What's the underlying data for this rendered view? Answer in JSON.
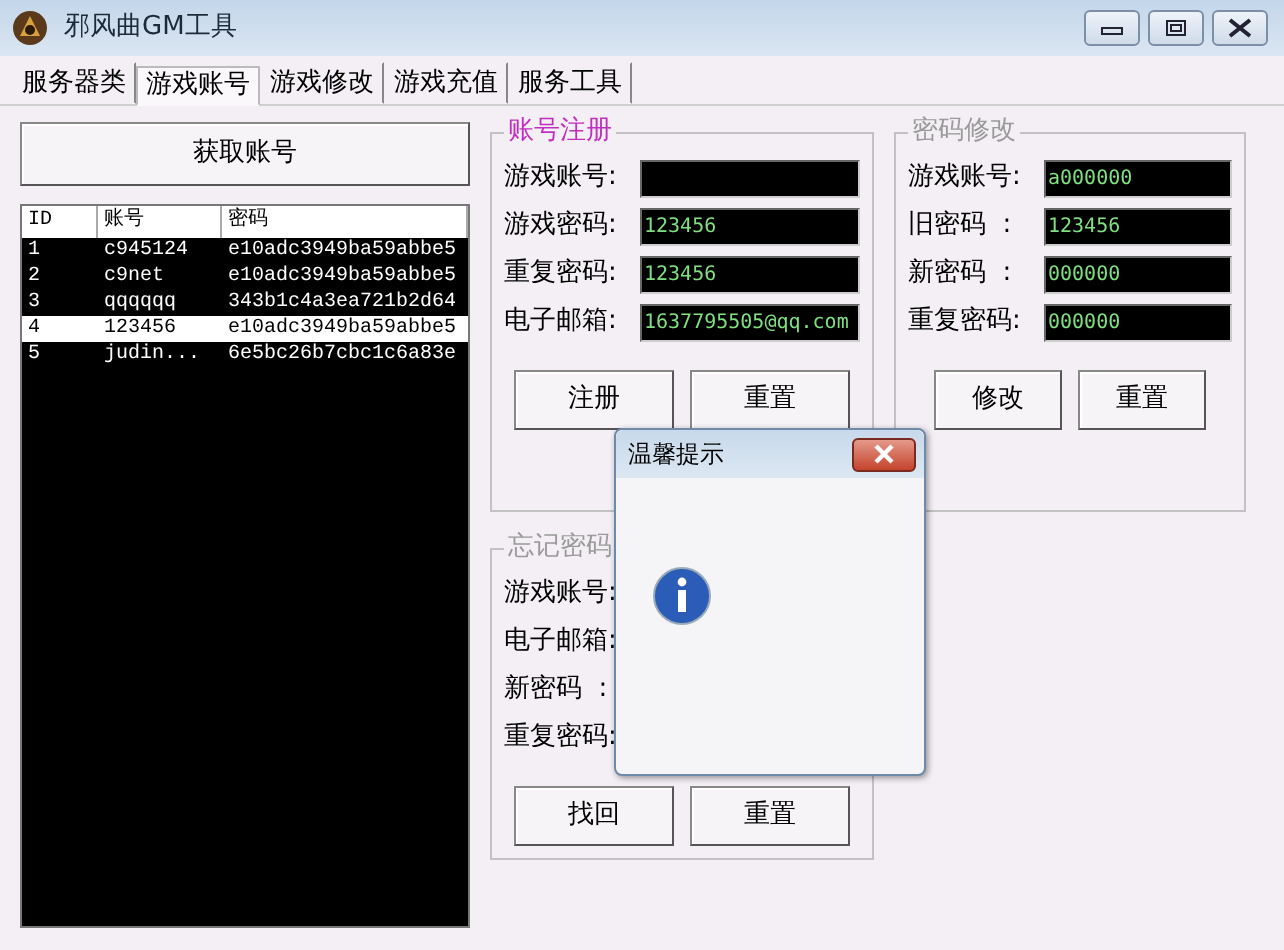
{
  "window": {
    "title": "邪风曲GM工具"
  },
  "tabs": [
    {
      "label": "服务器类",
      "selected": false
    },
    {
      "label": "游戏账号",
      "selected": true
    },
    {
      "label": "游戏修改",
      "selected": false
    },
    {
      "label": "游戏充值",
      "selected": false
    },
    {
      "label": "服务工具",
      "selected": false
    }
  ],
  "left_panel": {
    "button": "获取账号",
    "list": {
      "columns": [
        "ID",
        "账号",
        "密码"
      ],
      "rows": [
        {
          "cells": [
            "1",
            "c945124",
            "e10adc3949ba59abbe5"
          ],
          "selected": false
        },
        {
          "cells": [
            "2",
            "c9net",
            "e10adc3949ba59abbe5"
          ],
          "selected": false
        },
        {
          "cells": [
            "3",
            "qqqqqq",
            "343b1c4a3ea721b2d64"
          ],
          "selected": false
        },
        {
          "cells": [
            "4",
            "123456",
            "e10adc3949ba59abbe5"
          ],
          "selected": true
        },
        {
          "cells": [
            "5",
            "judin...",
            "6e5bc26b7cbc1c6a83e"
          ],
          "selected": false
        }
      ]
    }
  },
  "groups": [
    {
      "title": "账号注册",
      "focused": true,
      "fields": [
        {
          "label": "游戏账号:"
        },
        {
          "label": "游戏密码:",
          "value": "123456"
        },
        {
          "label": "重复密码:",
          "value": "123456"
        },
        {
          "label": "电子邮箱:",
          "value": "1637795505@qq.com"
        }
      ],
      "buttons": [
        "注册",
        "重置"
      ]
    },
    {
      "title": "密码修改",
      "focused": false,
      "fields": [
        {
          "label": "游戏账号:",
          "value": "a000000"
        },
        {
          "label": "旧密码  :",
          "value": "123456"
        },
        {
          "label": "新密码  :",
          "value": "000000"
        },
        {
          "label": "重复密码:",
          "value": "000000"
        }
      ],
      "buttons": [
        "修改",
        "重置"
      ]
    },
    {
      "title": "忘记密码",
      "focused": false,
      "fields": [
        {
          "label": "游戏账号:"
        },
        {
          "label": "电子邮箱:"
        },
        {
          "label": "新密码  :"
        },
        {
          "label": "重复密码:"
        }
      ],
      "buttons": [
        "找回",
        "重置"
      ]
    }
  ],
  "dialog": {
    "title": "温馨提示"
  }
}
